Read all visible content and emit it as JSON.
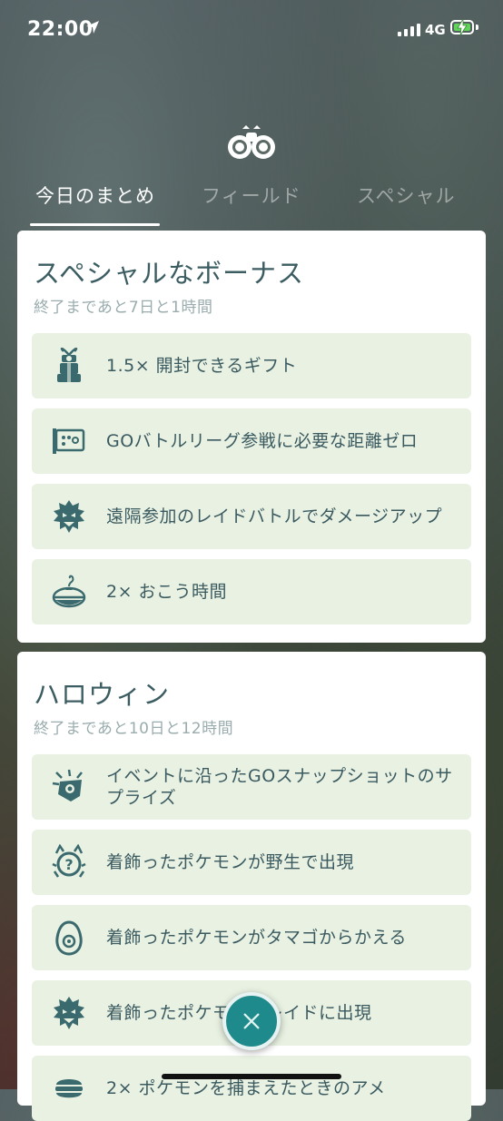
{
  "status_bar": {
    "time": "22:00",
    "network": "4G"
  },
  "tabs": [
    {
      "label": "今日のまとめ",
      "active": true
    },
    {
      "label": "フィールド",
      "active": false
    },
    {
      "label": "スペシャル",
      "active": false
    }
  ],
  "cards": [
    {
      "title": "スペシャルなボーナス",
      "subtitle": "終了まであと7日と1時間",
      "items": [
        {
          "icon": "gift-box-icon",
          "text": "1.5× 開封できるギフト"
        },
        {
          "icon": "battle-league-icon",
          "text": "GOバトルリーグ参戦に必要な距離ゼロ"
        },
        {
          "icon": "raid-boss-icon",
          "text": "遠隔参加のレイドバトルでダメージアップ"
        },
        {
          "icon": "incense-icon",
          "text": "2× おこう時間"
        }
      ]
    },
    {
      "title": "ハロウィン",
      "subtitle": "終了まであと10日と12時間",
      "items": [
        {
          "icon": "snapshot-camera-icon",
          "text": "イベントに沿ったGOスナップショットのサプライズ"
        },
        {
          "icon": "wild-pokemon-icon",
          "text": "着飾ったポケモンが野生で出現"
        },
        {
          "icon": "egg-icon",
          "text": "着飾ったポケモンがタマゴからかえる"
        },
        {
          "icon": "raid-boss-icon",
          "text": "着飾ったポケモンがレイドに出現"
        },
        {
          "icon": "candy-icon",
          "text": "2× ポケモンを捕まえたときのアメ"
        }
      ]
    }
  ],
  "colors": {
    "accent": "#1f8a8c",
    "item_bg": "#e8f1e2",
    "text": "#3a5a60"
  }
}
